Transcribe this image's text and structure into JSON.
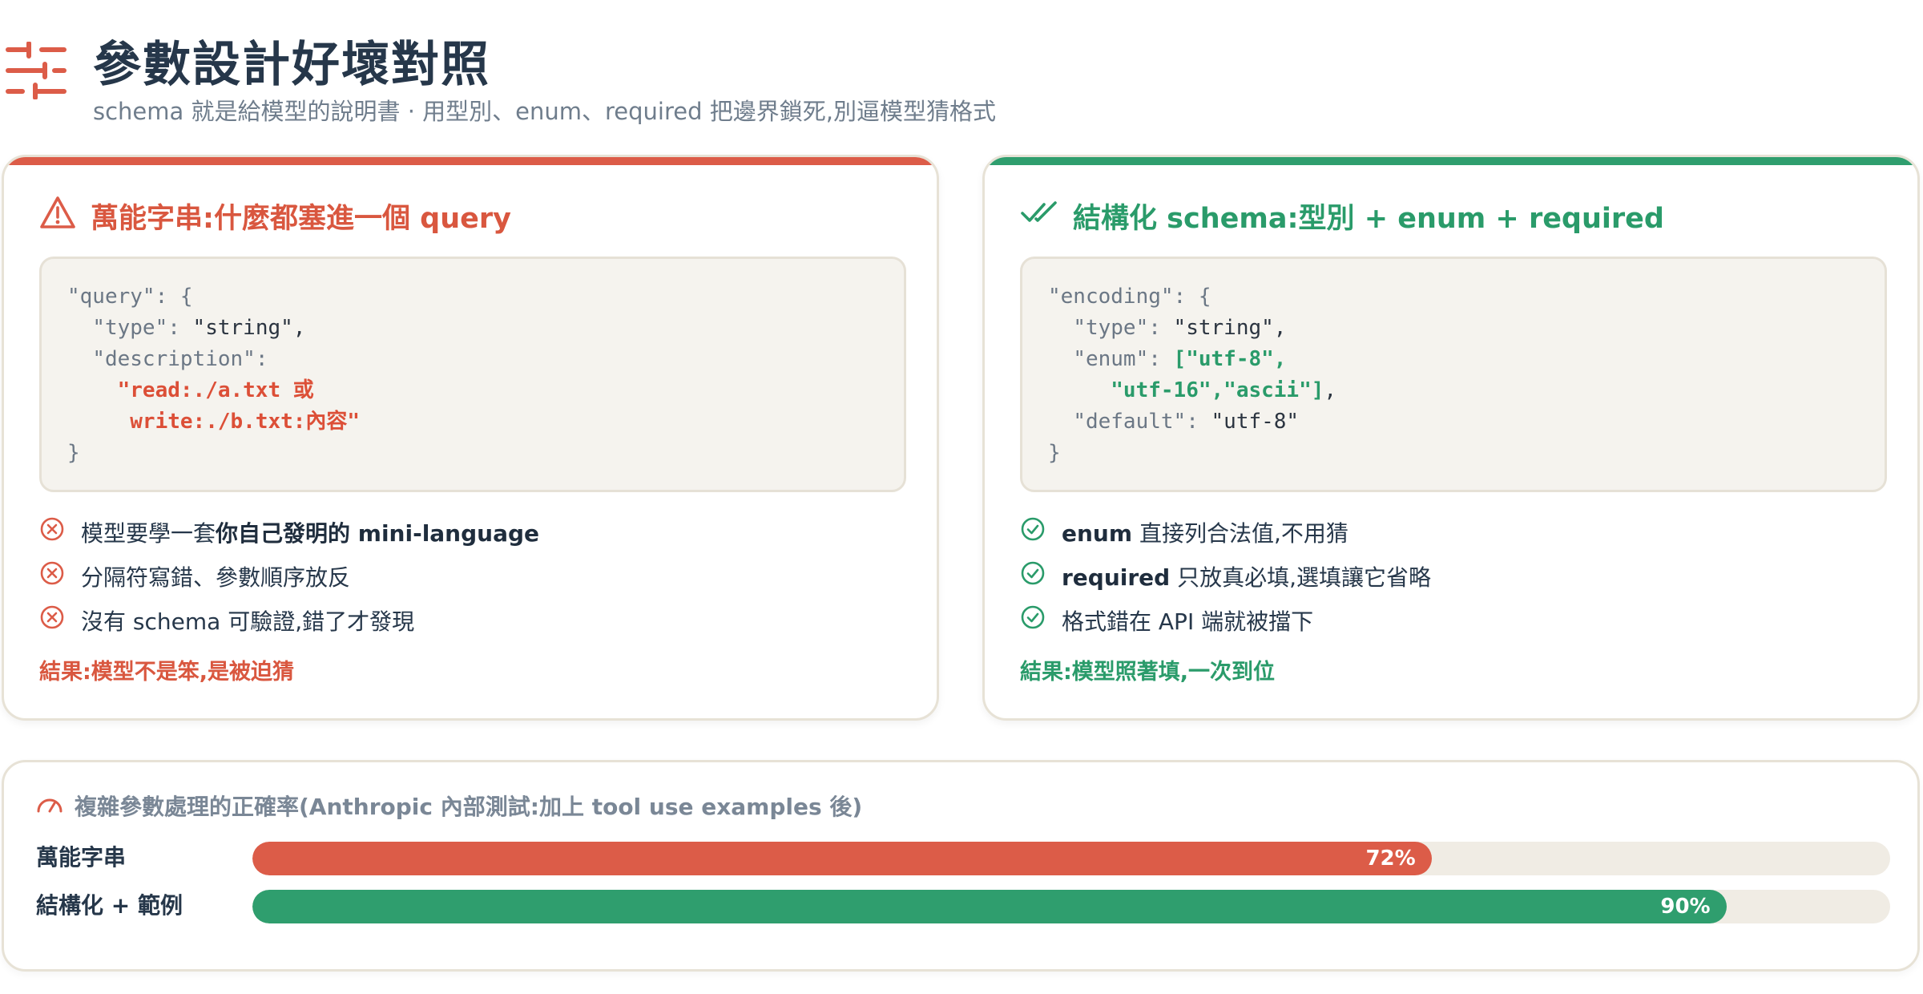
{
  "header": {
    "title": "參數設計好壞對照",
    "subtitle": "schema 就是給模型的說明書 · 用型別、enum、required 把邊界鎖死,別逼模型猜格式",
    "icon": "sliders-icon",
    "accent": "#dc5c48"
  },
  "bad": {
    "heading": "萬能字串:什麼都塞進一個 query",
    "icon": "warning-triangle-icon",
    "color": "#dc5c48",
    "code": {
      "l1_key": "\"query\"",
      "l1_rest": ": {",
      "l2_key": "\"type\"",
      "l2_sep": ": ",
      "l2_val": "\"string\",",
      "l3_key": "\"description\"",
      "l3_rest": ":",
      "l4": "\"read:./a.txt 或",
      "l5": "write:./b.txt:內容\"",
      "l6": "}"
    },
    "points": [
      {
        "pre": "模型要學一套",
        "strong": "你自己發明的 mini-language",
        "post": ""
      },
      {
        "pre": "分隔符寫錯、參數順序放反",
        "strong": "",
        "post": ""
      },
      {
        "pre": "沒有 schema 可驗證,錯了才發現",
        "strong": "",
        "post": ""
      }
    ],
    "result": "結果:模型不是笨,是被迫猜"
  },
  "good": {
    "heading": "結構化 schema:型別 + enum + required",
    "icon": "double-check-icon",
    "color": "#2f9e6e",
    "code": {
      "l1_key": "\"encoding\"",
      "l1_rest": ": {",
      "l2_key": "\"type\"",
      "l2_sep": ": ",
      "l2_val": "\"string\",",
      "l3_key": "\"enum\"",
      "l3_sep": ": ",
      "l3_val": "[\"utf-8\",",
      "l4_val": "\"utf-16\",\"ascii\"]",
      "l4_tail": ",",
      "l5_key": "\"default\"",
      "l5_sep": ": ",
      "l5_val": "\"utf-8\"",
      "l6": "}"
    },
    "points": [
      {
        "strong": "enum",
        "post": " 直接列合法值,不用猜"
      },
      {
        "strong": "required",
        "post": " 只放真必填,選填讓它省略"
      },
      {
        "strong": "",
        "post": "格式錯在 API 端就被擋下"
      }
    ],
    "result": "結果:模型照著填,一次到位"
  },
  "accuracy": {
    "title": "複雜參數處理的正確率(Anthropic 內部測試:加上 tool use examples 後)",
    "icon": "gauge-icon",
    "bars": [
      {
        "label": "萬能字串",
        "value": 72,
        "value_label": "72%",
        "color": "#dc5c48"
      },
      {
        "label": "結構化 + 範例",
        "value": 90,
        "value_label": "90%",
        "color": "#2f9e6e"
      }
    ]
  }
}
